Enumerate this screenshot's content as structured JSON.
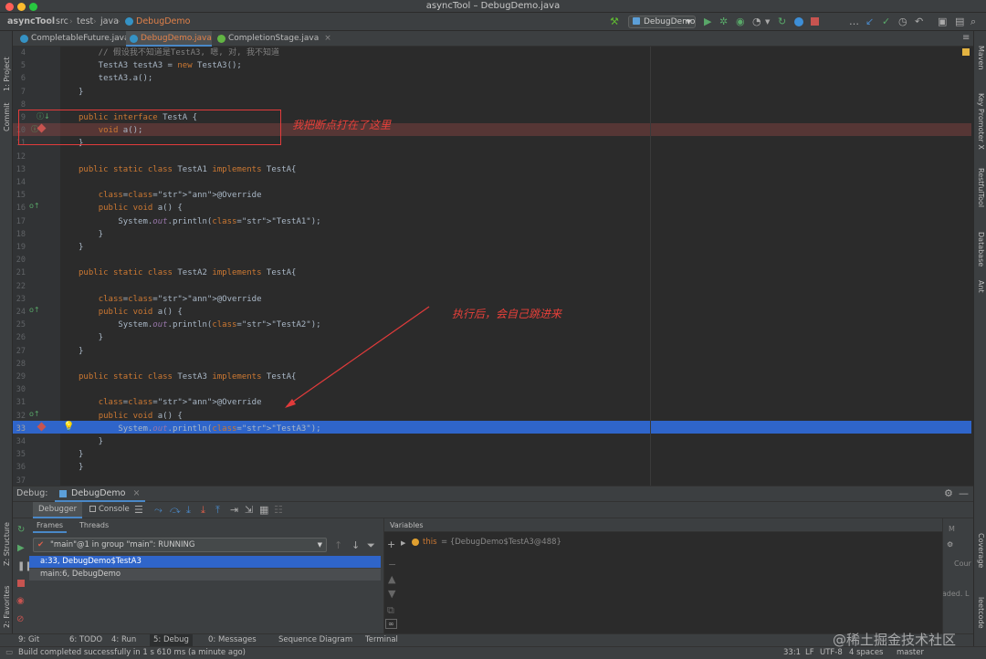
{
  "window": {
    "title": "asyncTool – DebugDemo.java"
  },
  "navbar": {
    "crumbs": [
      "asyncTool",
      "src",
      "test",
      "java",
      "DebugDemo"
    ],
    "run_config": "DebugDemo"
  },
  "tabs": [
    {
      "label": "CompletableFuture.java",
      "active": false
    },
    {
      "label": "DebugDemo.java",
      "active": true
    },
    {
      "label": "CompletionStage.java",
      "active": false
    }
  ],
  "left_strip": [
    "1: Project",
    "Commit"
  ],
  "left_strip_bottom": [
    "Z: Structure",
    "2: Favorites"
  ],
  "right_strip": [
    "Maven",
    "Key Promoter X",
    "RestfulTool",
    "Database",
    "Ant",
    "Coverage",
    "leetcode"
  ],
  "code_lines": [
    {
      "n": "4",
      "text": "    // 假设我不知道是TestA3, 嗯, 对, 我不知道"
    },
    {
      "n": "5",
      "text": "    TestA3 testA3 = new TestA3();"
    },
    {
      "n": "6",
      "text": "    testA3.a();"
    },
    {
      "n": "7",
      "text": "}"
    },
    {
      "n": "8",
      "text": ""
    },
    {
      "n": "9",
      "text": "public interface TestA {"
    },
    {
      "n": "10",
      "text": "    void a();"
    },
    {
      "n": "11",
      "text": "}"
    },
    {
      "n": "12",
      "text": ""
    },
    {
      "n": "13",
      "text": "public static class TestA1 implements TestA{"
    },
    {
      "n": "14",
      "text": ""
    },
    {
      "n": "15",
      "text": "    @Override"
    },
    {
      "n": "16",
      "text": "    public void a() {"
    },
    {
      "n": "17",
      "text": "        System.out.println(\"TestA1\");"
    },
    {
      "n": "18",
      "text": "    }"
    },
    {
      "n": "19",
      "text": "}"
    },
    {
      "n": "20",
      "text": ""
    },
    {
      "n": "21",
      "text": "public static class TestA2 implements TestA{"
    },
    {
      "n": "22",
      "text": ""
    },
    {
      "n": "23",
      "text": "    @Override"
    },
    {
      "n": "24",
      "text": "    public void a() {"
    },
    {
      "n": "25",
      "text": "        System.out.println(\"TestA2\");"
    },
    {
      "n": "26",
      "text": "    }"
    },
    {
      "n": "27",
      "text": "}"
    },
    {
      "n": "28",
      "text": ""
    },
    {
      "n": "29",
      "text": "public static class TestA3 implements TestA{"
    },
    {
      "n": "30",
      "text": ""
    },
    {
      "n": "31",
      "text": "    @Override"
    },
    {
      "n": "32",
      "text": "    public void a() {"
    },
    {
      "n": "33",
      "text": "        System.out.println(\"TestA3\");"
    },
    {
      "n": "34",
      "text": "    }"
    },
    {
      "n": "35",
      "text": "}"
    },
    {
      "n": "36",
      "text": "}"
    },
    {
      "n": "37",
      "text": ""
    }
  ],
  "annotations": {
    "breakpoint_note": "我把断点打在了这里",
    "after_note": "执行后，会自己跳进来"
  },
  "debug": {
    "label": "Debug:",
    "session": "DebugDemo",
    "tabs": [
      "Debugger",
      "Console"
    ],
    "subtabs": [
      "Frames",
      "Threads"
    ],
    "thread": "\"main\"@1 in group \"main\": RUNNING",
    "frames": [
      "a:33, DebugDemo$TestA3",
      "main:6, DebugDemo"
    ],
    "variables_title": "Variables",
    "variable": {
      "name": "this",
      "value": "= {DebugDemo$TestA3@488}"
    },
    "right_fragments": [
      "M",
      "Cour",
      "oaded. L"
    ]
  },
  "bottom_tabs": [
    "9: Git",
    "6: TODO",
    "4: Run",
    "5: Debug",
    "0: Messages",
    "Sequence Diagram",
    "Terminal"
  ],
  "status": {
    "message": "Build completed successfully in 1 s 610 ms (a minute ago)",
    "position": "33:1",
    "line_sep": "LF",
    "encoding": "UTF-8",
    "indent": "4 spaces",
    "branch": "master"
  },
  "watermark": "@稀土掘金技术社区",
  "colors": {
    "accent": "#2f65ca",
    "breakpoint": "#c75450",
    "annotation_red": "#e23b3b"
  }
}
